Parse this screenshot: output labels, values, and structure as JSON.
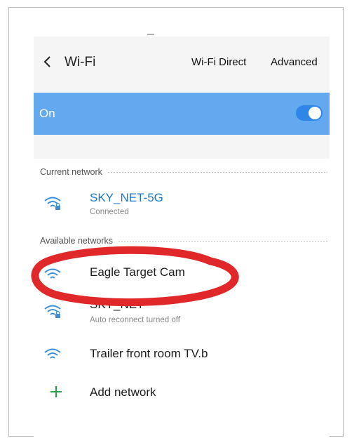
{
  "header": {
    "title": "Wi-Fi",
    "wifi_direct_label": "Wi-Fi Direct",
    "advanced_label": "Advanced"
  },
  "wifi_switch": {
    "label": "On",
    "enabled": true
  },
  "sections": {
    "current": "Current network",
    "available": "Available networks"
  },
  "current_network": {
    "name": "SKY_NET-5G",
    "status": "Connected"
  },
  "available_networks": [
    {
      "name": "Eagle Target Cam",
      "status": ""
    },
    {
      "name": "SKY_NET",
      "status": "Auto reconnect turned off"
    },
    {
      "name": "Trailer front room TV.b",
      "status": ""
    }
  ],
  "add_network_label": "Add network",
  "colors": {
    "accent_blue": "#62a9f0",
    "toggle_blue": "#2f86e8",
    "connected_text": "#1c78c9",
    "add_icon_green": "#2e9d4a",
    "annotation_red": "#e0282a"
  }
}
